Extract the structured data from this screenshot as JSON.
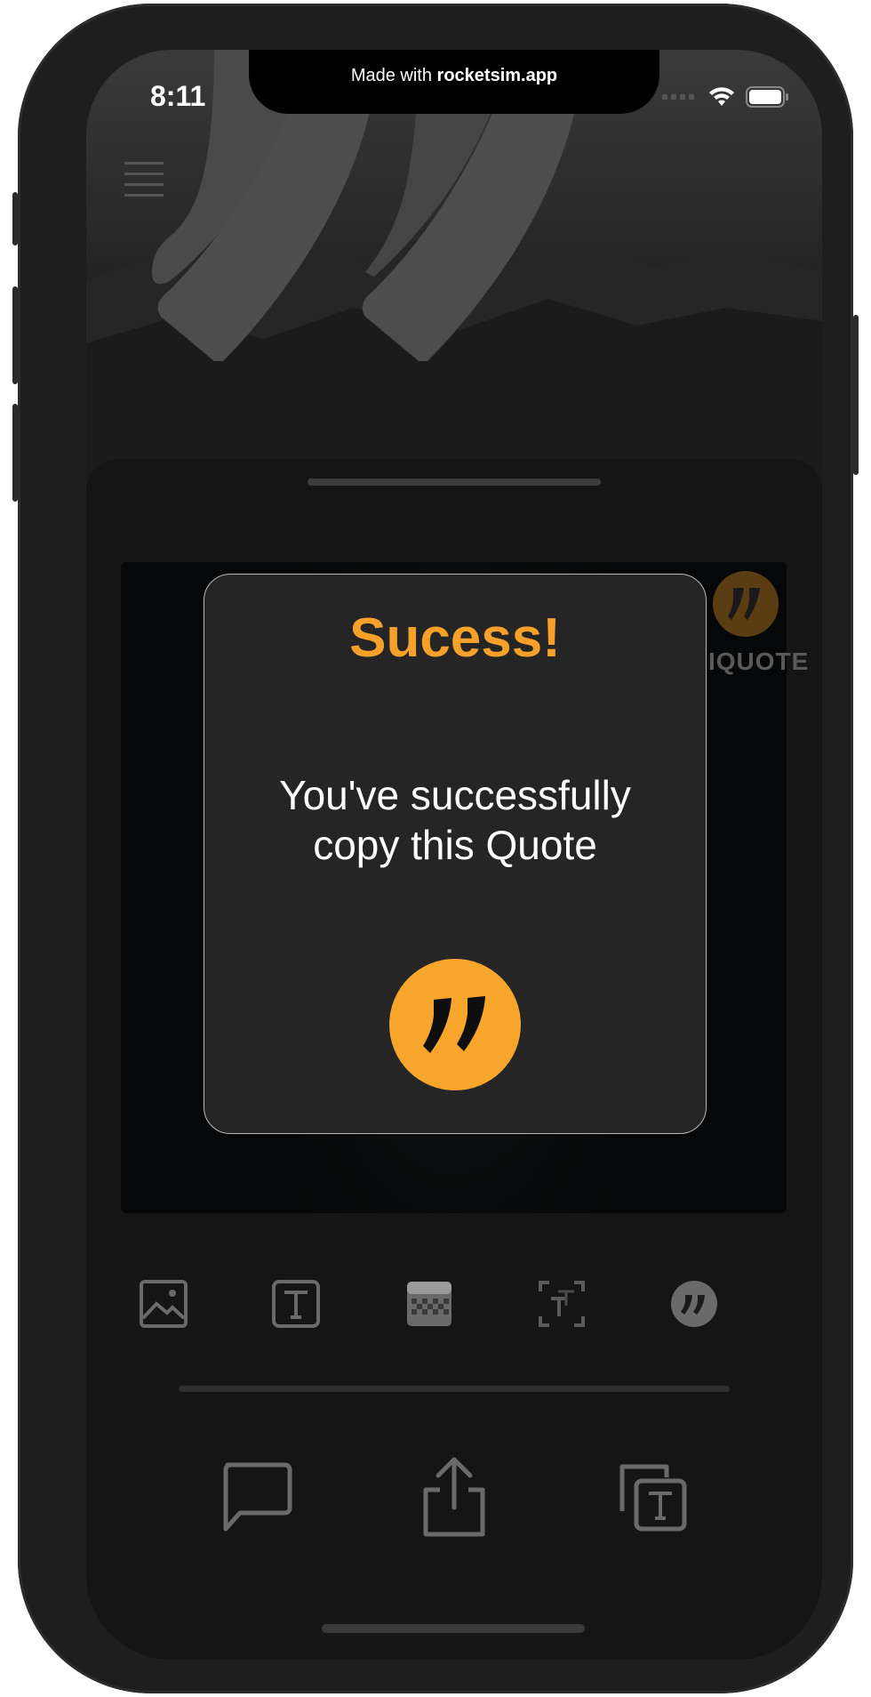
{
  "status_bar": {
    "time": "8:11",
    "notch_prefix": "Made with ",
    "notch_brand": "rocketsim.app"
  },
  "canvas": {
    "brand_text": "IQUOTE"
  },
  "modal": {
    "title": "Sucess!",
    "message": "You've successfully copy this Quote"
  },
  "toolbar": {
    "tools": [
      "image-icon",
      "text-icon",
      "background-pattern-icon",
      "text-layers-icon",
      "quote-logo-icon"
    ]
  },
  "actions": [
    "comment-icon",
    "share-icon",
    "copy-text-icon"
  ],
  "colors": {
    "accent": "#f7a52b",
    "modal_bg": "#252525",
    "sheet_bg": "#151515"
  }
}
